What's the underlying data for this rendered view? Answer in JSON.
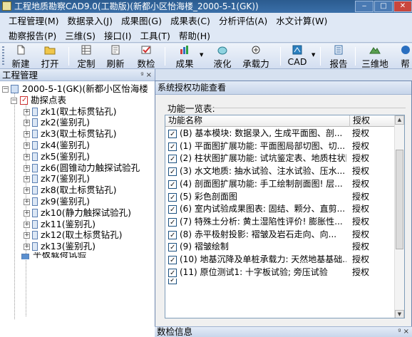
{
  "window": {
    "title": "工程地质勘察CAD9.0(工勘版)(新都小区怡海楼_2000-5-1(GK))",
    "buttons": [
      "‒",
      "□",
      "✕"
    ]
  },
  "menu_row1": [
    {
      "id": "project",
      "label": "工程管理(M)"
    },
    {
      "id": "data-entry",
      "label": "数据录入(J)"
    },
    {
      "id": "results-map",
      "label": "成果图(G)"
    },
    {
      "id": "results-table",
      "label": "成果表(C)"
    },
    {
      "id": "analysis",
      "label": "分析评估(A)"
    },
    {
      "id": "hydro",
      "label": "水文计算(W)"
    }
  ],
  "menu_row2": [
    {
      "id": "report",
      "label": "勘察报告(P)"
    },
    {
      "id": "3d",
      "label": "三维(S)"
    },
    {
      "id": "interface",
      "label": "接口(I)"
    },
    {
      "id": "tools",
      "label": "工具(T)"
    },
    {
      "id": "help",
      "label": "帮助(H)"
    }
  ],
  "toolbar": {
    "new": "新建",
    "open": "打开",
    "custom": "定制",
    "refresh": "刷新",
    "inspect": "数检",
    "results": "成果",
    "liquefaction": "液化",
    "bearing": "承载力",
    "cad": "CAD",
    "report": "报告",
    "three_d": "三维地",
    "help_trunc": "帮"
  },
  "left_panel": {
    "title": "工程管理",
    "pins": "ᵍ ×",
    "tree": {
      "root": "2000-5-1(GK)(新都小区怡海楼",
      "group": "勘探点表",
      "items": [
        "zk1(取土标贯钻孔)",
        "zk2(鉴别孔)",
        "zk3(取土标贯钻孔)",
        "zk4(鉴别孔)",
        "zk5(鉴别孔)",
        "zk6(圆锥动力触探试验孔",
        "zk7(鉴别孔)",
        "zk8(取土标贯钻孔)",
        "zk9(鉴别孔)",
        "zk10(静力触探试验孔)",
        "zk11(鉴别孔)",
        "zk12(取土标贯钻孔)",
        "zk13(鉴别孔)"
      ],
      "partial": "平板载荷试验"
    }
  },
  "dialog": {
    "title": "系统授权功能查看",
    "list_label": "功能一览表:",
    "columns": {
      "name": "功能名称",
      "auth": "授权"
    },
    "rows": [
      {
        "name": "(B) 基本模块: 数据录入, 生成平面图、剖...",
        "auth": "授权"
      },
      {
        "name": "(1) 平面图扩展功能: 平面图局部切图、切...",
        "auth": "授权"
      },
      {
        "name": "(2) 柱状图扩展功能: 试坑鉴定表、地质柱状图",
        "auth": "授权"
      },
      {
        "name": "(3) 水文地质: 抽水试验、注水试验、压水...",
        "auth": "授权"
      },
      {
        "name": "(4) 剖面图扩展功能: 手工绘制剖面图! 层...",
        "auth": "授权"
      },
      {
        "name": "(5) 彩色剖面图",
        "auth": "授权"
      },
      {
        "name": "(6) 室内试验成果图表: 固结、颗分、直剪...",
        "auth": "授权"
      },
      {
        "name": "(7) 特殊土分析: 黄土湿陷性评价! 膨胀性...",
        "auth": "授权"
      },
      {
        "name": "(8) 赤平极射投影: 褶皱及岩石走向、向...",
        "auth": "授权"
      },
      {
        "name": "(9) 褶皱绘制",
        "auth": "授权"
      },
      {
        "name": "(10) 地基沉降及单桩承载力: 天然地基基础...",
        "auth": "授权"
      },
      {
        "name": "(11) 原位测试1: 十字板试验; 旁压试验",
        "auth": "授权"
      },
      {
        "name": "",
        "auth": ""
      }
    ]
  },
  "bottom_panel": {
    "title": "数检信息",
    "pins": "ᵍ ×"
  },
  "colors": {
    "titlebar": "#2b5b8f",
    "chrome": "#d6e1f0",
    "close_button": "#c9463d"
  }
}
